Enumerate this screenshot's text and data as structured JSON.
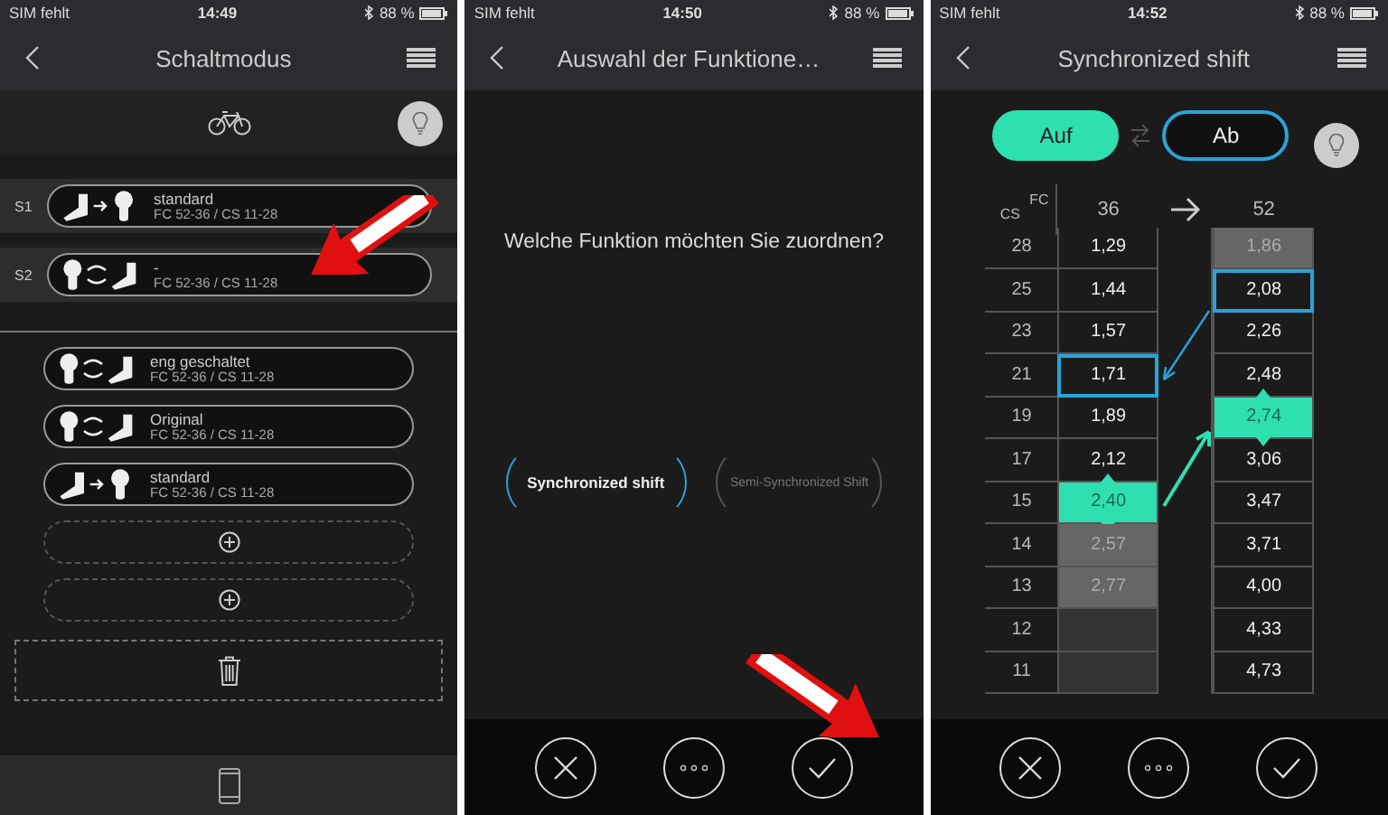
{
  "screens": [
    {
      "kind": "modes",
      "status": {
        "carrier": "SIM fehlt",
        "time": "14:49",
        "battery": "88 %"
      },
      "title": "Schaltmodus",
      "slots": [
        {
          "label": "S1",
          "mode": {
            "kind": "forward",
            "name": "standard",
            "gears": "FC 52-36 / CS 11-28"
          }
        },
        {
          "label": "S2",
          "mode": {
            "kind": "sync",
            "name": "-",
            "gears": "FC 52-36 / CS 11-28"
          }
        }
      ],
      "modes": [
        {
          "kind": "sync",
          "name": "eng geschaltet",
          "gears": "FC 52-36 / CS 11-28"
        },
        {
          "kind": "sync",
          "name": "Original",
          "gears": "FC 52-36 / CS 11-28"
        },
        {
          "kind": "forward",
          "name": "standard",
          "gears": "FC 52-36 / CS 11-28"
        }
      ],
      "add_slots": [
        {
          "kind": "add"
        },
        {
          "kind": "add"
        }
      ]
    },
    {
      "kind": "question",
      "status": {
        "carrier": "SIM fehlt",
        "time": "14:50",
        "battery": "88 %"
      },
      "title": "Auswahl der Funktione…",
      "question": "Welche Funktion möchten Sie zuordnen?",
      "options": [
        {
          "label": "Synchronized shift",
          "selected": true
        },
        {
          "label": "Semi-Synchronized Shift",
          "selected": false
        }
      ]
    },
    {
      "kind": "table",
      "status": {
        "carrier": "SIM fehlt",
        "time": "14:52",
        "battery": "88 %"
      },
      "title": "Synchronized shift",
      "toggle": [
        {
          "label": "Auf",
          "selected": true
        },
        {
          "label": "Ab",
          "selected": false
        }
      ],
      "table": {
        "cs_label": "CS",
        "fc_label": "FC",
        "columns": [
          "36",
          "52"
        ],
        "rows": [
          {
            "cs": "28",
            "cells": [
              {
                "value": "1,29",
                "kind": "normal"
              },
              {
                "value": "1,86",
                "kind": "disabled"
              }
            ]
          },
          {
            "cs": "25",
            "cells": [
              {
                "value": "1,44",
                "kind": "normal"
              },
              {
                "value": "2,08",
                "kind": "outlined"
              }
            ]
          },
          {
            "cs": "23",
            "cells": [
              {
                "value": "1,57",
                "kind": "normal"
              },
              {
                "value": "2,26",
                "kind": "normal"
              }
            ]
          },
          {
            "cs": "21",
            "cells": [
              {
                "value": "1,71",
                "kind": "outlined"
              },
              {
                "value": "2,48",
                "kind": "normal"
              }
            ]
          },
          {
            "cs": "19",
            "cells": [
              {
                "value": "1,89",
                "kind": "normal"
              },
              {
                "value": "2,74",
                "kind": "current"
              }
            ]
          },
          {
            "cs": "17",
            "cells": [
              {
                "value": "2,12",
                "kind": "normal"
              },
              {
                "value": "3,06",
                "kind": "normal"
              }
            ]
          },
          {
            "cs": "15",
            "cells": [
              {
                "value": "2,40",
                "kind": "current"
              },
              {
                "value": "3,47",
                "kind": "normal"
              }
            ]
          },
          {
            "cs": "14",
            "cells": [
              {
                "value": "2,57",
                "kind": "disabled"
              },
              {
                "value": "3,71",
                "kind": "normal"
              }
            ]
          },
          {
            "cs": "13",
            "cells": [
              {
                "value": "2,77",
                "kind": "disabled"
              },
              {
                "value": "4,00",
                "kind": "normal"
              }
            ]
          },
          {
            "cs": "12",
            "cells": [
              {
                "kind": "empty"
              },
              {
                "value": "4,33",
                "kind": "normal"
              }
            ]
          },
          {
            "cs": "11",
            "cells": [
              {
                "kind": "empty"
              },
              {
                "value": "4,73",
                "kind": "normal"
              }
            ]
          }
        ]
      }
    }
  ]
}
